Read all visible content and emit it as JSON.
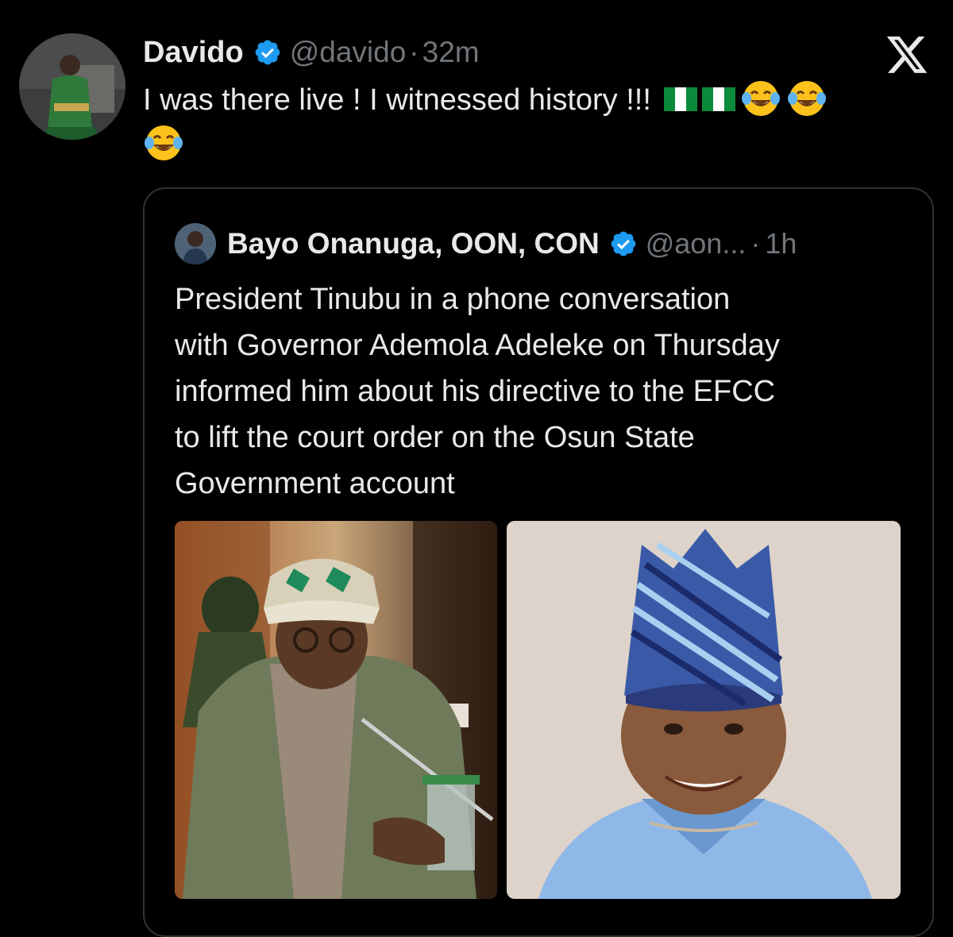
{
  "tweet": {
    "author_name": "Davido",
    "handle": "@davido",
    "separator": "·",
    "time": "32m",
    "text": "I was there live ! I witnessed history !!!",
    "emojis": [
      "nigeria-flag",
      "nigeria-flag",
      "tears-of-joy",
      "tears-of-joy",
      "tears-of-joy"
    ]
  },
  "quoted": {
    "author_name": "Bayo Onanuga, OON, CON",
    "handle": "@aon...",
    "separator": "·",
    "time": "1h",
    "lines": [
      "President Tinubu in a phone conversation",
      "with Governor Ademola Adeleke on Thursday",
      "informed him about his directive to the EFCC",
      "to lift the court order on the Osun State",
      "Government account"
    ],
    "images": [
      "photo-man-in-green-cap-at-microphone",
      "photo-man-in-blue-striped-cap"
    ]
  },
  "icons": {
    "brand": "x-logo",
    "verified": "verified-badge-icon"
  },
  "colors": {
    "background": "#000000",
    "text": "#e7e9ea",
    "muted": "#71767b",
    "verified": "#1d9bf0",
    "border": "#2f3336"
  }
}
